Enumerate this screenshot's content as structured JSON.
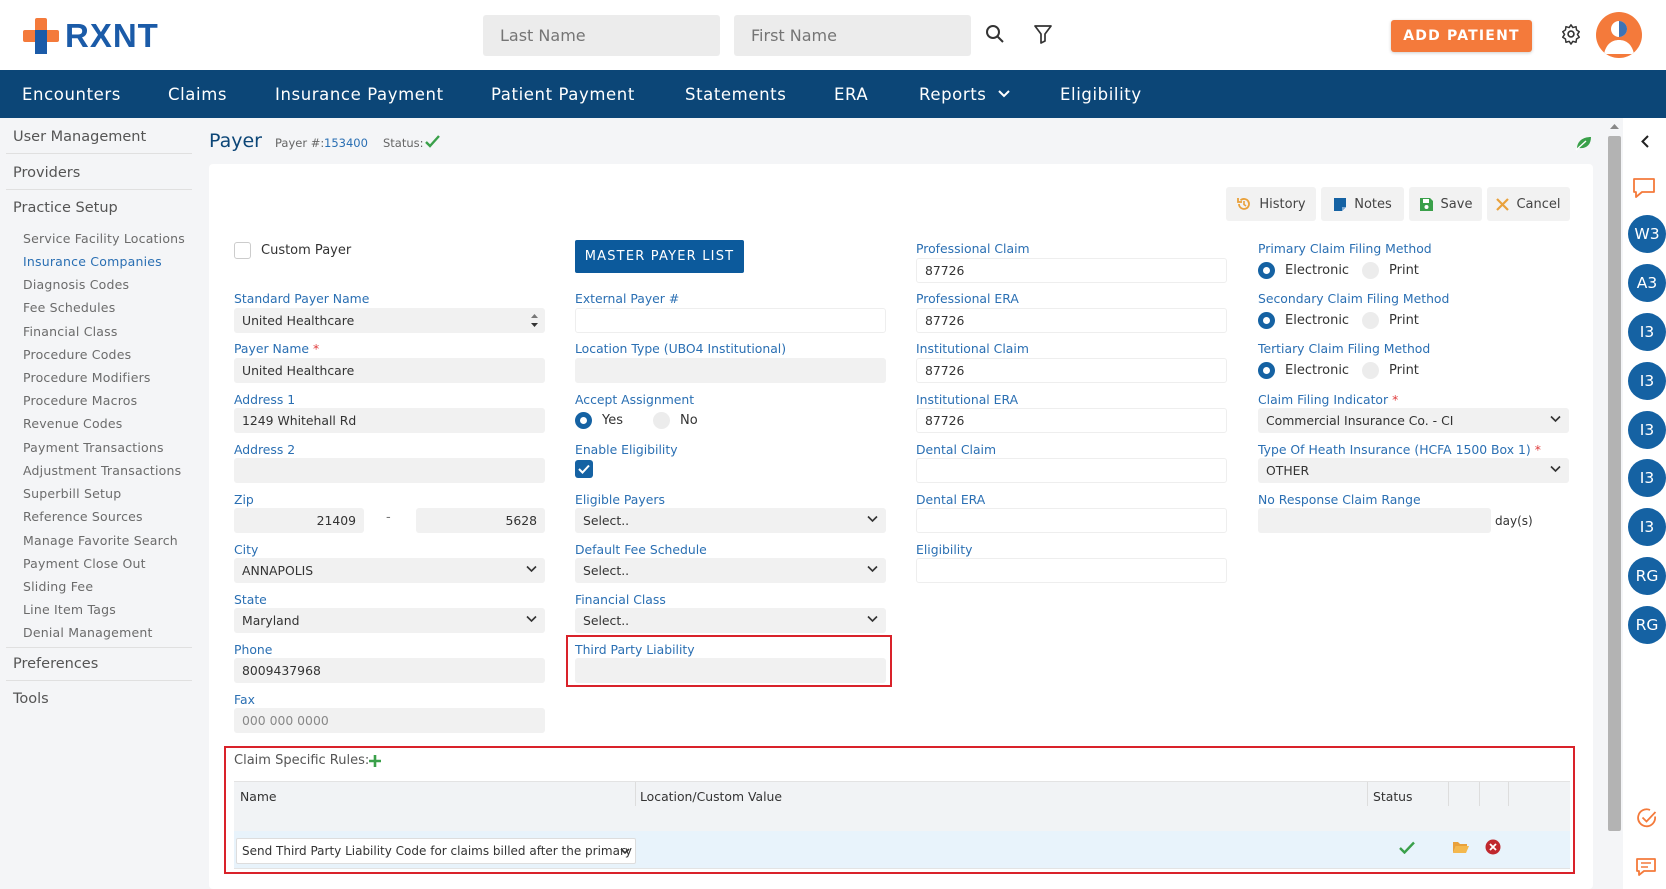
{
  "brand": {
    "name": "RXNT"
  },
  "search": {
    "last_name_placeholder": "Last Name",
    "first_name_placeholder": "First Name"
  },
  "top_actions": {
    "add_patient": "ADD PATIENT"
  },
  "nav": {
    "items": [
      "Encounters",
      "Claims",
      "Insurance Payment",
      "Patient Payment",
      "Statements",
      "ERA",
      "Reports",
      "Eligibility"
    ]
  },
  "sidebar": {
    "user_management": "User Management",
    "providers": "Providers",
    "practice_setup": "Practice Setup",
    "items": [
      "Service Facility Locations",
      "Insurance Companies",
      "Diagnosis Codes",
      "Fee Schedules",
      "Financial Class",
      "Procedure Codes",
      "Procedure Modifiers",
      "Procedure Macros",
      "Revenue Codes",
      "Payment Transactions",
      "Adjustment Transactions",
      "Superbill Setup",
      "Reference Sources",
      "Manage Favorite Search",
      "Payment Close Out",
      "Sliding Fee",
      "Line Item Tags",
      "Denial Management"
    ],
    "active_item": "Insurance Companies",
    "preferences": "Preferences",
    "tools": "Tools"
  },
  "page": {
    "title": "Payer",
    "payer_label": "Payer #:",
    "payer_number": "153400",
    "status_label": "Status:"
  },
  "actions": {
    "history": "History",
    "notes": "Notes",
    "save": "Save",
    "cancel": "Cancel"
  },
  "form": {
    "custom_payer": "Custom Payer",
    "master_payer_list": "MASTER PAYER LIST",
    "standard_payer_name": {
      "label": "Standard Payer Name",
      "value": "United Healthcare"
    },
    "payer_name": {
      "label": "Payer Name",
      "value": "United Healthcare"
    },
    "address1": {
      "label": "Address 1",
      "value": "1249 Whitehall Rd"
    },
    "address2": {
      "label": "Address 2",
      "value": ""
    },
    "zip": {
      "label": "Zip",
      "value": "21409",
      "ext": "5628",
      "dash": "-"
    },
    "city": {
      "label": "City",
      "value": "ANNAPOLIS"
    },
    "state": {
      "label": "State",
      "value": "Maryland"
    },
    "phone": {
      "label": "Phone",
      "value": "8009437968"
    },
    "fax": {
      "label": "Fax",
      "placeholder": "000 000 0000"
    },
    "external_payer": {
      "label": "External Payer #",
      "value": ""
    },
    "location_type": {
      "label": "Location Type (UBO4 Institutional)",
      "value": ""
    },
    "accept_assignment": {
      "label": "Accept Assignment",
      "yes": "Yes",
      "no": "No",
      "selected": "Yes"
    },
    "enable_eligibility": {
      "label": "Enable Eligibility",
      "checked": true
    },
    "eligible_payers": {
      "label": "Eligible Payers",
      "value": "Select.."
    },
    "default_fee_schedule": {
      "label": "Default Fee Schedule",
      "value": "Select.."
    },
    "financial_class": {
      "label": "Financial Class",
      "value": "Select.."
    },
    "third_party_liability": {
      "label": "Third Party Liability",
      "value": ""
    },
    "professional_claim": {
      "label": "Professional Claim",
      "value": "87726"
    },
    "professional_era": {
      "label": "Professional ERA",
      "value": "87726"
    },
    "institutional_claim": {
      "label": "Institutional Claim",
      "value": "87726"
    },
    "institutional_era": {
      "label": "Institutional ERA",
      "value": "87726"
    },
    "dental_claim": {
      "label": "Dental Claim",
      "value": ""
    },
    "dental_era": {
      "label": "Dental ERA",
      "value": ""
    },
    "eligibility": {
      "label": "Eligibility",
      "value": ""
    },
    "primary_filing": {
      "label": "Primary Claim Filing Method",
      "electronic": "Electronic",
      "print": "Print",
      "selected": "Electronic"
    },
    "secondary_filing": {
      "label": "Secondary Claim Filing Method",
      "electronic": "Electronic",
      "print": "Print",
      "selected": "Electronic"
    },
    "tertiary_filing": {
      "label": "Tertiary Claim Filing Method",
      "electronic": "Electronic",
      "print": "Print",
      "selected": "Electronic"
    },
    "claim_filing_indicator": {
      "label": "Claim Filing Indicator",
      "value": "Commercial Insurance Co. - CI"
    },
    "type_of_health_insurance": {
      "label": "Type Of Heath Insurance (HCFA 1500 Box 1)",
      "value": "OTHER"
    },
    "no_response_claim_range": {
      "label": "No Response Claim Range",
      "value": "",
      "unit": "day(s)"
    }
  },
  "rules": {
    "title": "Claim Specific Rules:",
    "columns": [
      "Name",
      "Location/Custom Value",
      "Status"
    ],
    "row": {
      "name": "Send Third Party Liability Code for claims billed after the primary cla",
      "value": ""
    }
  },
  "right_panel": {
    "avatars": [
      "W3",
      "A3",
      "I3",
      "I3",
      "I3",
      "I3",
      "I3",
      "RG",
      "RG"
    ]
  },
  "colors": {
    "brand_blue": "#0c4677",
    "accent_orange": "#f47a3b",
    "link_blue": "#2a6fb3",
    "highlight_red": "#d9222a",
    "status_green": "#3aa04a"
  }
}
